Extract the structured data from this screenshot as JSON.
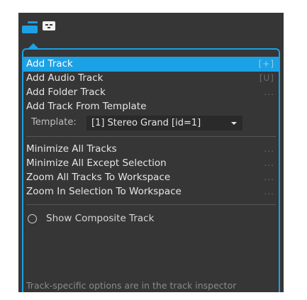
{
  "toolbar": {
    "icons": [
      "tracks-view-icon",
      "mixer-view-icon"
    ]
  },
  "menu": {
    "items": [
      {
        "label": "Add Track",
        "shortcut": "[+]",
        "active": true
      },
      {
        "label": "Add Audio Track",
        "shortcut": "[U]"
      },
      {
        "label": "Add Folder Track",
        "shortcut": "..."
      },
      {
        "label": "Add Track From Template",
        "shortcut": ""
      }
    ],
    "template": {
      "label": "Template:",
      "value": "[1] Stereo Grand [id=1]"
    },
    "view_items": [
      {
        "label": "Minimize All Tracks",
        "shortcut": "..."
      },
      {
        "label": "Minimize All Except Selection",
        "shortcut": "..."
      },
      {
        "label": "Zoom All Tracks To Workspace",
        "shortcut": "..."
      },
      {
        "label": "Zoom In Selection To Workspace",
        "shortcut": "..."
      }
    ],
    "composite": {
      "label": "Show Composite Track",
      "checked": false
    },
    "footer": "Track-specific options are in the track inspector"
  },
  "colors": {
    "panel_bg": "#363636",
    "accent": "#1ba1e6",
    "text": "#e6e6e6",
    "muted": "#8a8a8a"
  }
}
